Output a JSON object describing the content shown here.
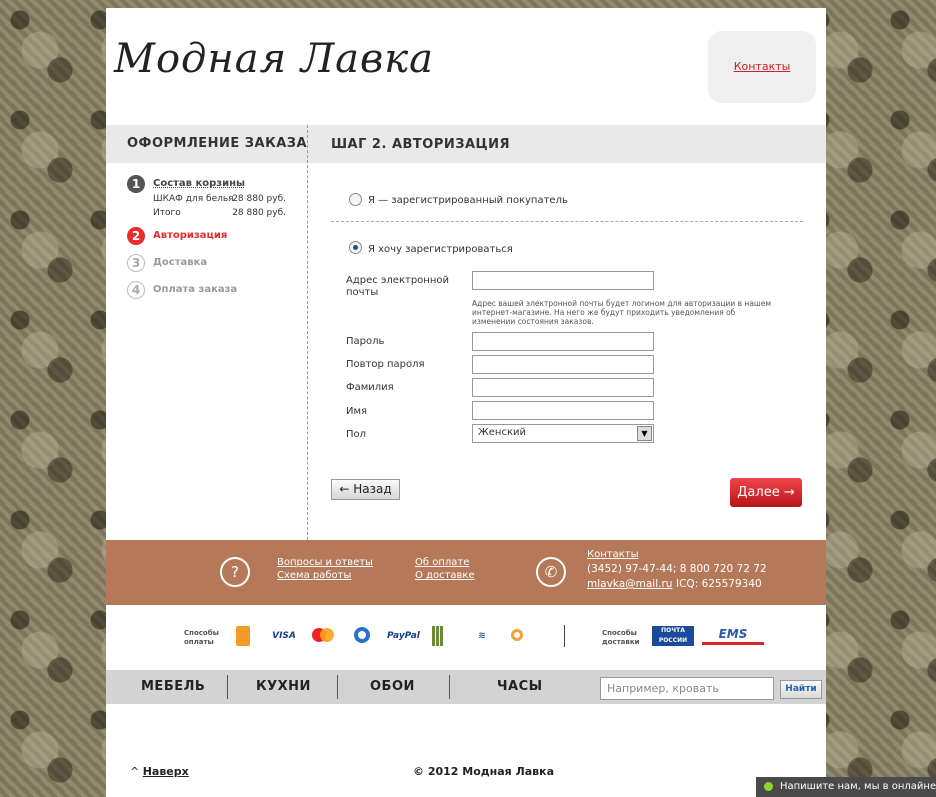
{
  "header": {
    "logo": "Модная Лавка",
    "contacts_link": "Контакты"
  },
  "checkout": {
    "title": "ОФОРМЛЕНИЕ ЗАКАЗА",
    "step_title": "ШАГ 2. АВТОРИЗАЦИЯ"
  },
  "steps": [
    {
      "num": "1",
      "label": "Состав корзины"
    },
    {
      "num": "2",
      "label": "Авторизация"
    },
    {
      "num": "3",
      "label": "Доставка"
    },
    {
      "num": "4",
      "label": "Оплата заказа"
    }
  ],
  "cart": {
    "item_name": "ШКАФ для белья",
    "item_price": "28 880 руб.",
    "total_label": "Итого",
    "total_price": "28 880 руб."
  },
  "form": {
    "radio_registered": "Я — зарегистрированный покупатель",
    "radio_register": "Я хочу зарегистрироваться",
    "email_label": "Адрес электронной почты",
    "email_hint": "Адрес вашей электронной почты будет логином для авторизации в нашем интернет-магазине. На него же будут приходить уведомления об изменении состояния заказов.",
    "password_label": "Пароль",
    "password_repeat_label": "Повтор пароля",
    "surname_label": "Фамилия",
    "name_label": "Имя",
    "gender_label": "Пол",
    "gender_value": "Женский",
    "back_button": "← Назад",
    "next_button": "Далее →"
  },
  "footer_info": {
    "faq_link": "Вопросы и ответы",
    "schedule_link": "Схема работы",
    "payment_link": "Об оплате",
    "delivery_link": "О доставке",
    "contacts_link": "Контакты",
    "phones": "(3452) 97-47-44; 8 800 720 72 72",
    "email": "mlavka@mail.ru",
    "icq": "ICQ: 625579340"
  },
  "payments": {
    "pay_label": "Способы оплаты",
    "delivery_label": "Способы доставки",
    "methods": [
      "VISA",
      "PayPal"
    ],
    "delivery_methods": [
      "ПОЧТА РОССИИ",
      "EMS"
    ]
  },
  "nav": {
    "items": [
      "МЕБЕЛЬ",
      "КУХНИ",
      "ОБОИ",
      "ЧАСЫ"
    ],
    "search_placeholder": "Например, кровать",
    "search_button": "Найти"
  },
  "bottom": {
    "to_top_arrow": "^",
    "to_top": "Наверх",
    "copyright": "©  2012 Модная Лавка"
  },
  "chat": {
    "text": "Напишите нам, мы в онлайне!"
  },
  "colors": {
    "accent": "#e62d2d",
    "footer_bg": "#b57959",
    "nav_bg": "#d3d3d3"
  }
}
